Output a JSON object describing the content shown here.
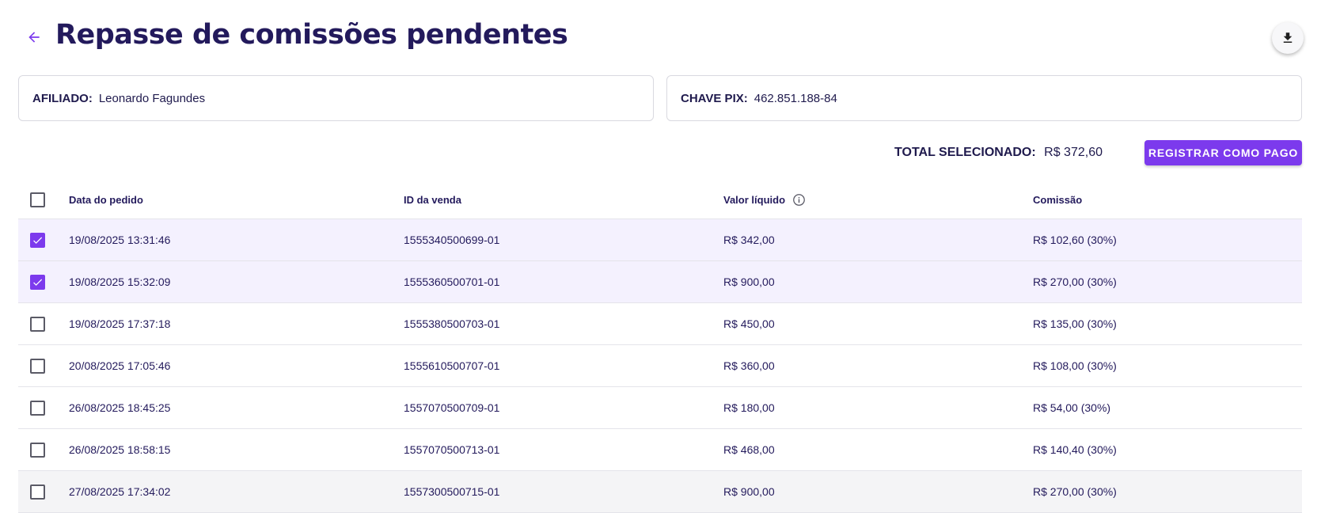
{
  "header": {
    "title": "Repasse de comissões pendentes",
    "back_icon": "arrow-left-icon",
    "download_icon": "download-icon"
  },
  "info": {
    "afiliado_label": "AFILIADO:",
    "afiliado_value": "Leonardo Fagundes",
    "pix_label": "CHAVE PIX:",
    "pix_value": "462.851.188-84"
  },
  "summary": {
    "total_label": "TOTAL SELECIONADO:",
    "total_value": "R$ 372,60",
    "pay_button": "REGISTRAR COMO PAGO"
  },
  "table": {
    "columns": [
      "Data do pedido",
      "ID da venda",
      "Valor líquido",
      "Comissão"
    ],
    "rows": [
      {
        "date": "19/08/2025 13:31:46",
        "id": "1555340500699-01",
        "valor": "R$ 342,00",
        "comissao": "R$ 102,60 (30%)",
        "checked": true
      },
      {
        "date": "19/08/2025 15:32:09",
        "id": "1555360500701-01",
        "valor": "R$ 900,00",
        "comissao": "R$ 270,00 (30%)",
        "checked": true
      },
      {
        "date": "19/08/2025 17:37:18",
        "id": "1555380500703-01",
        "valor": "R$ 450,00",
        "comissao": "R$ 135,00 (30%)",
        "checked": false
      },
      {
        "date": "20/08/2025 17:05:46",
        "id": "1555610500707-01",
        "valor": "R$ 360,00",
        "comissao": "R$ 108,00 (30%)",
        "checked": false
      },
      {
        "date": "26/08/2025 18:45:25",
        "id": "1557070500709-01",
        "valor": "R$ 180,00",
        "comissao": "R$ 54,00 (30%)",
        "checked": false
      },
      {
        "date": "26/08/2025 18:58:15",
        "id": "1557070500713-01",
        "valor": "R$ 468,00",
        "comissao": "R$ 140,40 (30%)",
        "checked": false
      },
      {
        "date": "27/08/2025 17:34:02",
        "id": "1557300500715-01",
        "valor": "R$ 900,00",
        "comissao": "R$ 270,00 (30%)",
        "checked": false
      }
    ]
  },
  "colors": {
    "accent": "#7c3aed",
    "text": "#231a5c",
    "selected_row": "#f4f1fe"
  }
}
